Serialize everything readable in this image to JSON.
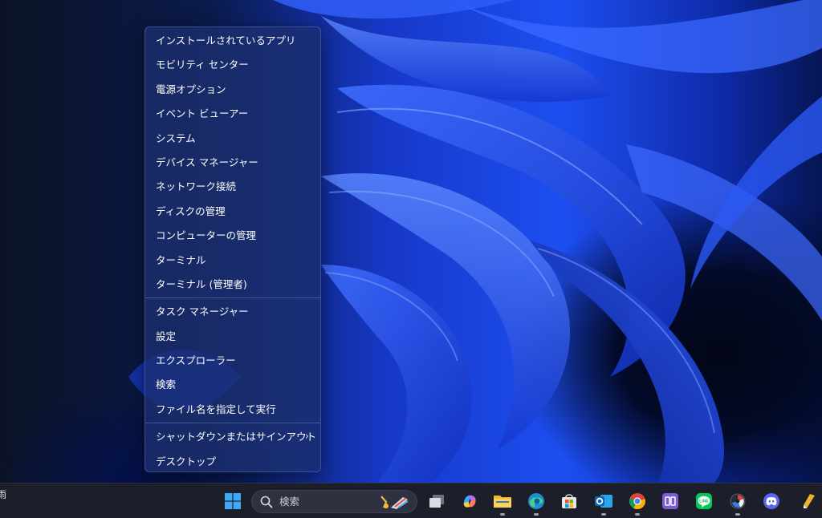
{
  "context_menu": {
    "group1": [
      {
        "label": "インストールされているアプリ"
      },
      {
        "label": "モビリティ センター"
      },
      {
        "label": "電源オプション"
      },
      {
        "label": "イベント ビューアー"
      },
      {
        "label": "システム"
      },
      {
        "label": "デバイス マネージャー"
      },
      {
        "label": "ネットワーク接続"
      },
      {
        "label": "ディスクの管理"
      },
      {
        "label": "コンピューターの管理"
      },
      {
        "label": "ターミナル"
      },
      {
        "label": "ターミナル (管理者)"
      }
    ],
    "group2": [
      {
        "label": "タスク マネージャー"
      },
      {
        "label": "設定"
      },
      {
        "label": "エクスプローラー"
      },
      {
        "label": "検索"
      },
      {
        "label": "ファイル名を指定して実行"
      }
    ],
    "group3": [
      {
        "label": "シャットダウンまたはサインアウト",
        "submenu_chevron": "›"
      },
      {
        "label": "デスクトップ"
      }
    ]
  },
  "taskbar": {
    "left_text": "雨",
    "search": {
      "label": "検索",
      "icon": "search-icon"
    },
    "apps": [
      {
        "name": "start",
        "icon": "windows-logo-icon"
      },
      {
        "name": "task-view",
        "icon": "task-view-icon"
      },
      {
        "name": "copilot",
        "icon": "copilot-icon"
      },
      {
        "name": "file-explorer",
        "icon": "folder-icon",
        "running": true
      },
      {
        "name": "edge",
        "icon": "edge-icon",
        "running": true
      },
      {
        "name": "store",
        "icon": "store-icon"
      },
      {
        "name": "outlook",
        "icon": "outlook-icon",
        "running": true
      },
      {
        "name": "chrome",
        "icon": "chrome-icon",
        "running": true
      },
      {
        "name": "app-purple",
        "icon": "purple-app-icon"
      },
      {
        "name": "line",
        "icon": "line-icon",
        "label": "LINE"
      },
      {
        "name": "davinci",
        "icon": "davinci-icon",
        "running": true
      },
      {
        "name": "discord",
        "icon": "discord-icon"
      },
      {
        "name": "pen-app",
        "icon": "pen-icon"
      }
    ]
  },
  "colors": {
    "menu_bg": "#1c3070",
    "taskbar_bg": "#1c1f2a",
    "wallpaper_blue": "#1d4ef0"
  }
}
